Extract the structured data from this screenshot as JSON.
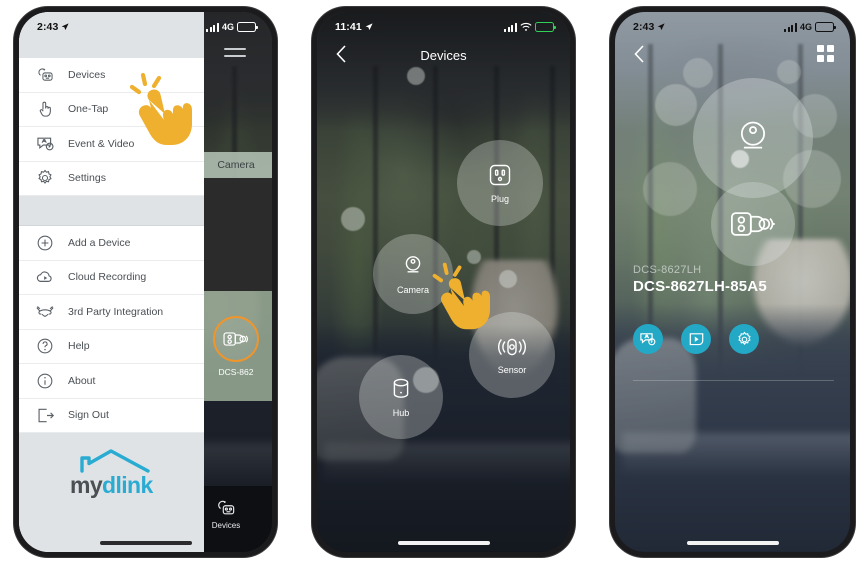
{
  "colors": {
    "brand_cyan": "#23a8c6",
    "logo_cyan": "#29abd2",
    "logo_gray": "#4a4f54",
    "accent_orange": "#f0952a",
    "hand_yellow": "#efb02f",
    "drawer_bg": "#ffffff",
    "drawer_panel": "#dfe3e6",
    "battery_green": "#31d158"
  },
  "phone1": {
    "status": {
      "time": "2:43",
      "network": "4G",
      "location_icon": "location-arrow-icon",
      "signal_icon": "signal-bars-icon",
      "battery_icon": "battery-icon"
    },
    "menu": {
      "primary": [
        {
          "label": "Devices",
          "icon": "devices-icon"
        },
        {
          "label": "One-Tap",
          "icon": "one-tap-hand-icon"
        },
        {
          "label": "Event & Video",
          "icon": "event-video-icon"
        },
        {
          "label": "Settings",
          "icon": "gear-icon"
        }
      ],
      "secondary": [
        {
          "label": "Add a Device",
          "icon": "plus-circle-icon"
        },
        {
          "label": "Cloud Recording",
          "icon": "cloud-play-icon"
        },
        {
          "label": "3rd Party Integration",
          "icon": "handshake-icon"
        },
        {
          "label": "Help",
          "icon": "question-circle-icon"
        },
        {
          "label": "About",
          "icon": "info-circle-icon"
        },
        {
          "label": "Sign Out",
          "icon": "sign-out-icon"
        }
      ]
    },
    "logo": {
      "my": "my",
      "dlink": "dlink",
      "icon": "house-roof-icon"
    },
    "background_panel": {
      "menu_icon": "hamburger-menu-icon",
      "section_label": "Camera",
      "device_name": "DCS-862",
      "device_icon": "camera-device-icon"
    },
    "tabbar": {
      "label": "Devices",
      "icon": "devices-icon"
    }
  },
  "phone2": {
    "status": {
      "time": "11:41",
      "location_icon": "location-arrow-icon",
      "signal_icon": "signal-bars-icon",
      "wifi_icon": "wifi-icon",
      "battery_icon": "battery-charging-icon"
    },
    "navbar": {
      "title": "Devices",
      "back_icon": "chevron-left-icon"
    },
    "device_types": [
      {
        "label": "Plug",
        "icon": "plug-outlet-icon"
      },
      {
        "label": "Camera",
        "icon": "camera-lens-icon"
      },
      {
        "label": "Sensor",
        "icon": "motion-sensor-icon"
      },
      {
        "label": "Hub",
        "icon": "hub-cylinder-icon"
      }
    ]
  },
  "phone3": {
    "status": {
      "time": "2:43",
      "network": "4G",
      "location_icon": "location-arrow-icon",
      "signal_icon": "signal-bars-icon",
      "battery_icon": "battery-icon"
    },
    "navbar": {
      "back_icon": "chevron-left-icon",
      "grid_icon": "grid-view-icon"
    },
    "device": {
      "model": "DCS-8627LH",
      "full_name": "DCS-8627LH-85A5",
      "lens_icon": "camera-lens-icon",
      "device_icon": "camera-device-icon"
    },
    "actions": [
      {
        "icon": "event-video-icon",
        "name": "event-video-button"
      },
      {
        "icon": "playback-icon",
        "name": "playback-button"
      },
      {
        "icon": "gear-icon",
        "name": "settings-button"
      }
    ]
  }
}
